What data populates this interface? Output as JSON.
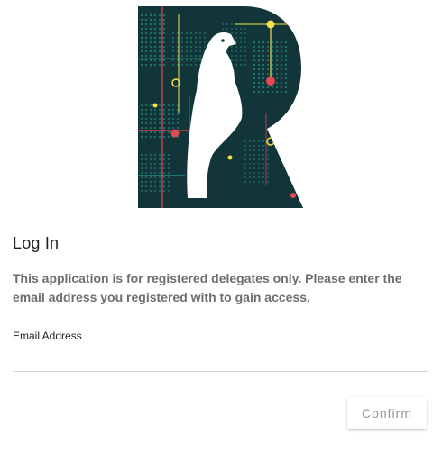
{
  "logo": {
    "icon": "r-eagle-logo",
    "background_color": "#12353a",
    "accent_color": "#f6e04a"
  },
  "login": {
    "title": "Log In",
    "description": "This application is for registered delegates only. Please enter the email address you registered with to gain access.",
    "email": {
      "label": "Email Address",
      "value": "",
      "placeholder": ""
    },
    "confirm_label": "Confirm"
  },
  "colors": {
    "title": "#212121",
    "description": "#6e6e6e",
    "button_text": "#8f9aa1",
    "input_underline": "#d6d6d6"
  }
}
